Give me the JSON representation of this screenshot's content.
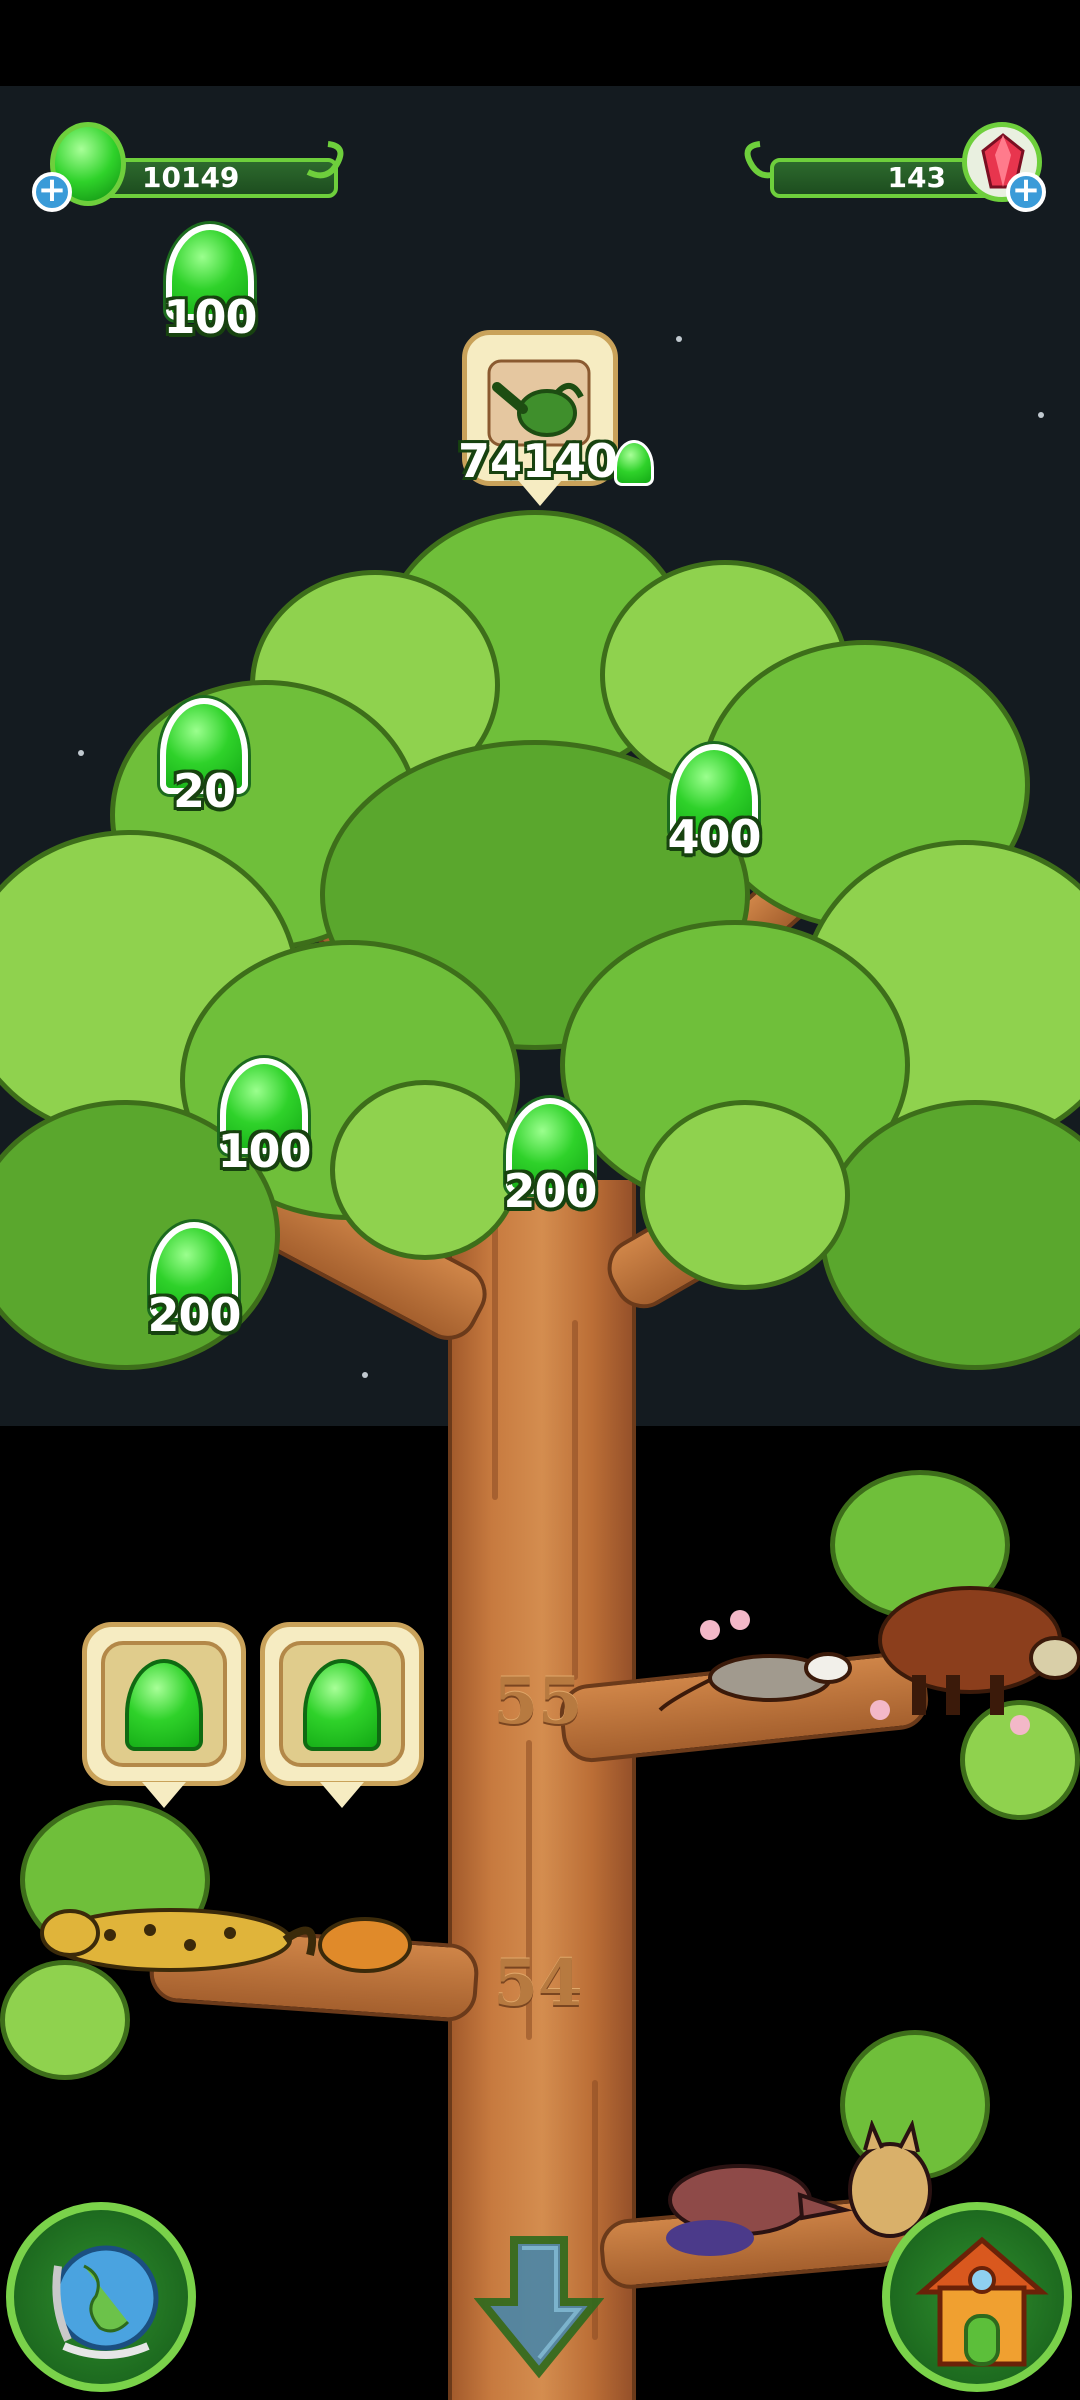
{
  "hud": {
    "jelly_amount": "10149",
    "gem_amount": "143",
    "add_jelly_icon": "plus-icon",
    "add_gem_icon": "plus-icon"
  },
  "colors": {
    "sky": "#141b20",
    "leaf": "#6fbf3a",
    "trunk": "#c77a3f",
    "jelly": "#2fd22a",
    "bar_border": "#6ecf3c"
  },
  "tree": {
    "watering_cost": "74140",
    "watering_icon": "watering-can-icon",
    "levels": [
      "55",
      "54"
    ],
    "jelly_pickups": [
      "100",
      "20",
      "400",
      "100",
      "200",
      "200"
    ]
  },
  "pending_rewards": {
    "icon": "jelly-drop-icon",
    "count": 2
  },
  "nav": {
    "globe_icon": "globe-icon",
    "scroll_down_icon": "arrow-down-icon",
    "home_icon": "house-icon"
  }
}
